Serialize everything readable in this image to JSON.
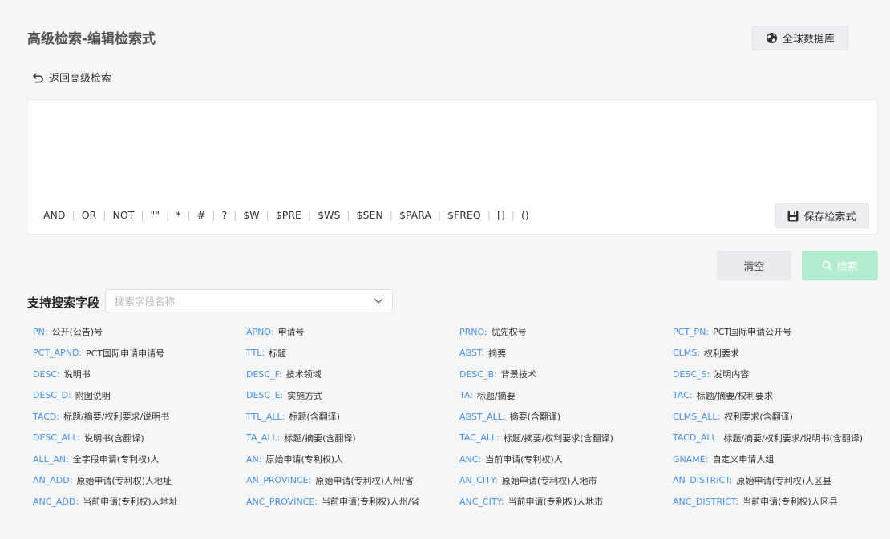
{
  "header": {
    "title": "高级检索-编辑检索式",
    "global_db_label": "全球数据库"
  },
  "back": {
    "label": "返回高级检索"
  },
  "editor": {
    "value": "",
    "operators": [
      "AND",
      "OR",
      "NOT",
      "\"\"",
      "*",
      "#",
      "?",
      "$W",
      "$PRE",
      "$WS",
      "$SEN",
      "$PARA",
      "$FREQ",
      "[]",
      "()"
    ],
    "save_label": "保存检索式"
  },
  "actions": {
    "clear_label": "清空",
    "search_label": "检索"
  },
  "fields": {
    "label": "支持搜索字段",
    "select_placeholder": "搜索字段名称",
    "items": [
      {
        "code": "PN:",
        "desc": "公开(公告)号"
      },
      {
        "code": "APNO:",
        "desc": "申请号"
      },
      {
        "code": "PRNO:",
        "desc": "优先权号"
      },
      {
        "code": "PCT_PN:",
        "desc": "PCT国际申请公开号"
      },
      {
        "code": "PCT_APNO:",
        "desc": "PCT国际申请申请号"
      },
      {
        "code": "TTL:",
        "desc": "标题"
      },
      {
        "code": "ABST:",
        "desc": "摘要"
      },
      {
        "code": "CLMS:",
        "desc": "权利要求"
      },
      {
        "code": "DESC:",
        "desc": "说明书"
      },
      {
        "code": "DESC_F:",
        "desc": "技术领域"
      },
      {
        "code": "DESC_B:",
        "desc": "背景技术"
      },
      {
        "code": "DESC_S:",
        "desc": "发明内容"
      },
      {
        "code": "DESC_D:",
        "desc": "附图说明"
      },
      {
        "code": "DESC_E:",
        "desc": "实施方式"
      },
      {
        "code": "TA:",
        "desc": "标题/摘要"
      },
      {
        "code": "TAC:",
        "desc": "标题/摘要/权利要求"
      },
      {
        "code": "TACD:",
        "desc": "标题/摘要/权利要求/说明书"
      },
      {
        "code": "TTL_ALL:",
        "desc": "标题(含翻译)"
      },
      {
        "code": "ABST_ALL:",
        "desc": "摘要(含翻译)"
      },
      {
        "code": "CLMS_ALL:",
        "desc": "权利要求(含翻译)"
      },
      {
        "code": "DESC_ALL:",
        "desc": "说明书(含翻译)"
      },
      {
        "code": "TA_ALL:",
        "desc": "标题/摘要(含翻译)"
      },
      {
        "code": "TAC_ALL:",
        "desc": "标题/摘要/权利要求(含翻译)"
      },
      {
        "code": "TACD_ALL:",
        "desc": "标题/摘要/权利要求/说明书(含翻译)"
      },
      {
        "code": "ALL_AN:",
        "desc": "全字段申请(专利权)人"
      },
      {
        "code": "AN:",
        "desc": "原始申请(专利权)人"
      },
      {
        "code": "ANC:",
        "desc": "当前申请(专利权)人"
      },
      {
        "code": "GNAME:",
        "desc": "自定义申请人组"
      },
      {
        "code": "AN_ADD:",
        "desc": "原始申请(专利权)人地址"
      },
      {
        "code": "AN_PROVINCE:",
        "desc": "原始申请(专利权)人州/省"
      },
      {
        "code": "AN_CITY:",
        "desc": "原始申请(专利权)人地市"
      },
      {
        "code": "AN_DISTRICT:",
        "desc": "原始申请(专利权)人区县"
      },
      {
        "code": "ANC_ADD:",
        "desc": "当前申请(专利权)人地址"
      },
      {
        "code": "ANC_PROVINCE:",
        "desc": "当前申请(专利权)人州/省"
      },
      {
        "code": "ANC_CITY:",
        "desc": "当前申请(专利权)人地市"
      },
      {
        "code": "ANC_DISTRICT:",
        "desc": "当前申请(专利权)人区县"
      }
    ]
  }
}
